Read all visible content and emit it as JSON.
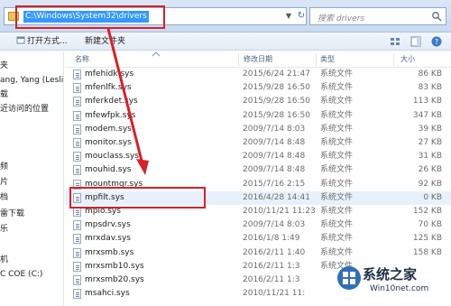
{
  "address_bar": {
    "path": "C:\\Windows\\System32\\drivers",
    "search_placeholder": "搜索 drivers"
  },
  "toolbar": {
    "open_label": "打开方式...",
    "new_folder_label": "新建文件夹"
  },
  "nav": {
    "items": [
      "夹",
      "ang, Yang (Leslie",
      "载",
      "近访问的位置",
      "",
      "",
      "频",
      "片",
      "档",
      "雷下载",
      "乐",
      "",
      "机",
      "C COE (C:)"
    ]
  },
  "columns": {
    "name": "名称",
    "date": "修改日期",
    "type": "类型",
    "size": "大小"
  },
  "files": [
    {
      "name": "mfehidk.sys",
      "date": "2015/6/24 21:47",
      "type": "系统文件",
      "size": "86 KB"
    },
    {
      "name": "mfenlfk.sys",
      "date": "2015/9/28 16:50",
      "type": "系统文件",
      "size": "83 KB"
    },
    {
      "name": "mferkdet.sys",
      "date": "2015/9/28 16:50",
      "type": "系统文件",
      "size": "113 KB"
    },
    {
      "name": "mfewfpk.sys",
      "date": "2015/9/28 16:50",
      "type": "系统文件",
      "size": "347 KB"
    },
    {
      "name": "modem.sys",
      "date": "2009/7/14 8:03",
      "type": "系统文件",
      "size": "39 KB"
    },
    {
      "name": "monitor.sys",
      "date": "2009/7/14 8:48",
      "type": "系统文件",
      "size": "27 KB"
    },
    {
      "name": "mouclass.sys",
      "date": "2009/7/14 8:48",
      "type": "系统文件",
      "size": "31 KB"
    },
    {
      "name": "mouhid.sys",
      "date": "2009/7/14 8:48",
      "type": "系统文件",
      "size": "26 KB"
    },
    {
      "name": "mountmgr.sys",
      "date": "2015/7/16 2:15",
      "type": "系统文件",
      "size": "92 KB"
    },
    {
      "name": "mpfilt.sys",
      "date": "2016/4/28 14:41",
      "type": "系统文件",
      "size": "0 KB"
    },
    {
      "name": "mpio.sys",
      "date": "2010/11/21 11:23",
      "type": "系统文件",
      "size": "152 KB"
    },
    {
      "name": "mpsdrv.sys",
      "date": "2009/7/14 8:03",
      "type": "系统文件",
      "size": "70 KB"
    },
    {
      "name": "mrxdav.sys",
      "date": "2016/1/8 1:49",
      "type": "系统文件",
      "size": "125 KB"
    },
    {
      "name": "mrxsmb.sys",
      "date": "2016/2/11 1:40",
      "type": "系统文件",
      "size": "158 KB"
    },
    {
      "name": "mrxsmb10.sys",
      "date": "2016/2/11 1:3",
      "type": "系统文件",
      "size": ""
    },
    {
      "name": "mrxsmb20.sys",
      "date": "2016/2/11 1:3",
      "type": "",
      "size": ""
    },
    {
      "name": "msahci.sys",
      "date": "2010/11/21 11:",
      "type": "",
      "size": ""
    }
  ],
  "watermark": {
    "brand": "系统之家",
    "url": "Win10net.com"
  },
  "colors": {
    "highlight_red": "#d8202a",
    "address_selection": "#3399ff"
  }
}
